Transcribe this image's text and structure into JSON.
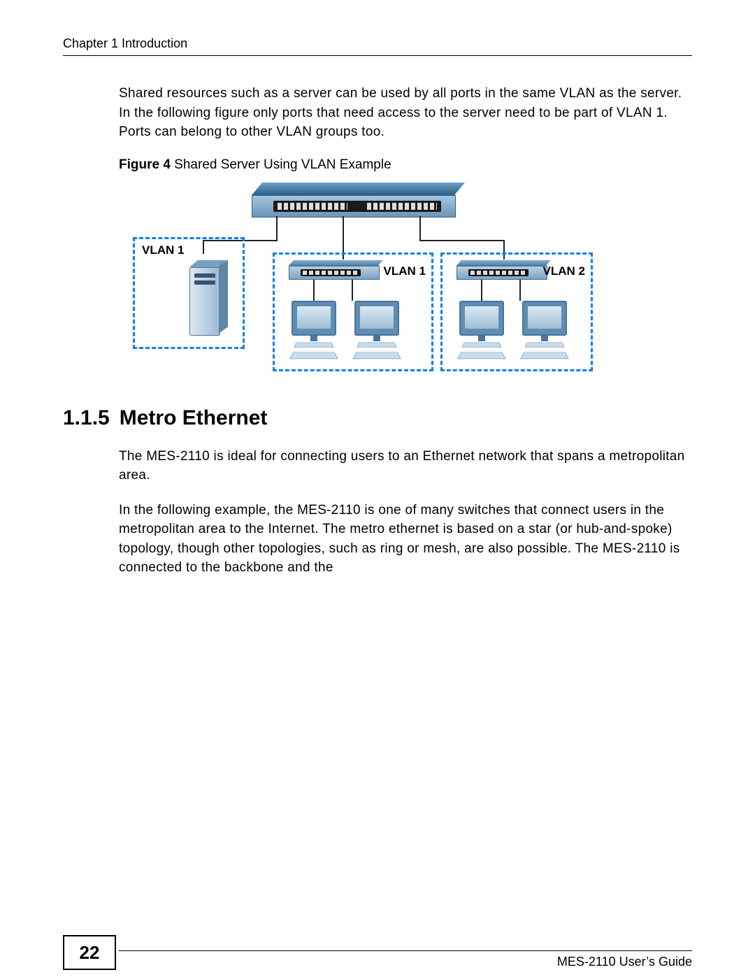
{
  "header": {
    "chapter": "Chapter 1 Introduction"
  },
  "intro_para": "Shared resources such as a server can be used by all ports in the same VLAN as the server. In the following figure only ports that need access to the server need to be part of VLAN 1. Ports can belong to other VLAN groups too.",
  "figure": {
    "label_bold": "Figure 4",
    "label_rest": "   Shared Server Using VLAN Example",
    "vlan_left": "VLAN 1",
    "vlan_mid_right": "VLAN 1",
    "vlan_right": "VLAN 2"
  },
  "section": {
    "number": "1.1.5",
    "title": "Metro Ethernet",
    "p1": "The MES-2110 is ideal for connecting users to an Ethernet network that spans a metropolitan area.",
    "p2": "In the following example, the MES-2110 is one of many switches that connect users in the metropolitan area to the Internet. The metro ethernet is based on a star (or hub-and-spoke) topology, though other topologies, such as ring or mesh, are also possible. The MES-2110 is connected to the backbone and the"
  },
  "footer": {
    "page": "22",
    "guide": "MES-2110 User’s Guide"
  }
}
